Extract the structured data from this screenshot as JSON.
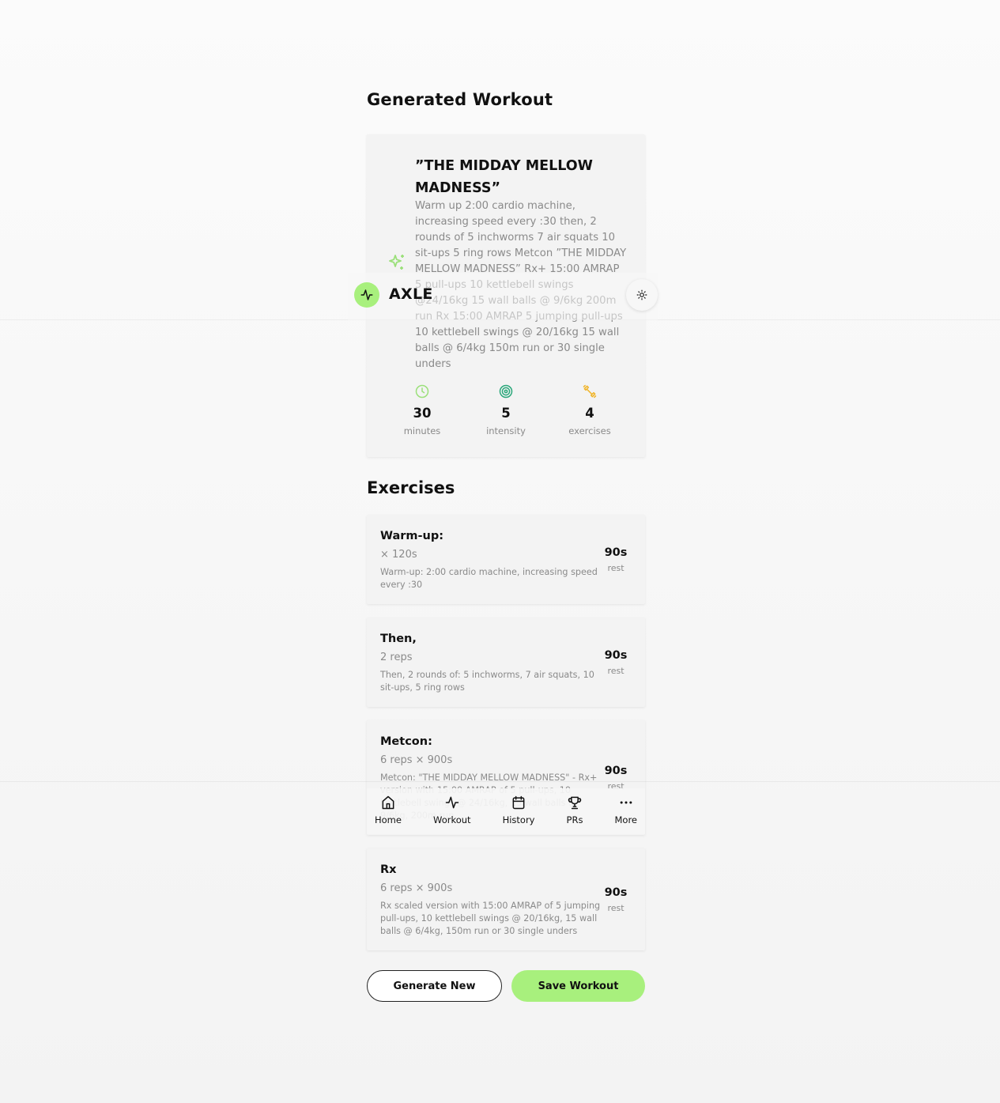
{
  "page": {
    "title": "Generated Workout"
  },
  "workout": {
    "title": "”THE MIDDAY MELLOW MADNESS”",
    "description": "Warm up 2:00 cardio machine, increasing speed every :30 then, 2 rounds of 5 inchworms 7 air squats 10 sit-ups 5 ring rows Metcon ”THE MIDDAY MELLOW MADNESS” Rx+ 15:00 AMRAP 5 pull-ups 10 kettlebell swings @24/16kg 15 wall balls @ 9/6kg 200m run Rx 15:00 AMRAP 5 jumping pull-ups 10 kettlebell swings @ 20/16kg 15 wall balls @ 6/4kg 150m run or 30 single unders",
    "stats": [
      {
        "icon": "clock-icon",
        "value": "30",
        "label": "minutes"
      },
      {
        "icon": "target-icon",
        "value": "5",
        "label": "intensity"
      },
      {
        "icon": "dumbbell-icon",
        "value": "4",
        "label": "exercises"
      }
    ]
  },
  "exercises_section": {
    "title": "Exercises"
  },
  "exercises": [
    {
      "name": "Warm-up:",
      "sets": "× 120s",
      "note": "Warm-up: 2:00 cardio machine, increasing speed every :30",
      "rest_value": "90s",
      "rest_label": "rest"
    },
    {
      "name": "Then,",
      "sets": "2 reps",
      "note": "Then, 2 rounds of: 5 inchworms, 7 air squats, 10 sit-ups, 5 ring rows",
      "rest_value": "90s",
      "rest_label": "rest"
    },
    {
      "name": "Metcon:",
      "sets": "6 reps × 900s",
      "note": "Metcon: \"THE MIDDAY MELLOW MADNESS\" - Rx+ version with 15:00 AMRAP of 5 pull-ups, 10 kettlebell swings @ 24/16kg, 15 wall balls @ 9/6kg, 200m run",
      "rest_value": "90s",
      "rest_label": "rest"
    },
    {
      "name": "Rx",
      "sets": "6 reps × 900s",
      "note": "Rx scaled version with 15:00 AMRAP of 5 jumping pull-ups, 10 kettlebell swings @ 20/16kg, 15 wall balls @ 6/4kg, 150m run or 30 single unders",
      "rest_value": "90s",
      "rest_label": "rest"
    }
  ],
  "actions": {
    "generate_new": "Generate New",
    "save_workout": "Save Workout"
  },
  "header": {
    "app_name": "AXLE",
    "logo_icon": "activity-icon",
    "theme_icon": "sun-icon"
  },
  "nav": [
    {
      "icon": "home-icon",
      "label": "Home"
    },
    {
      "icon": "activity-icon",
      "label": "Workout"
    },
    {
      "icon": "calendar-icon",
      "label": "History"
    },
    {
      "icon": "trophy-icon",
      "label": "PRs"
    },
    {
      "icon": "more-icon",
      "label": "More"
    }
  ],
  "colors": {
    "accent": "#a8f07d",
    "clock": "#9be07a",
    "target": "#2aa77a",
    "dumbbell": "#f0b429",
    "muted": "#8a8a8a"
  }
}
